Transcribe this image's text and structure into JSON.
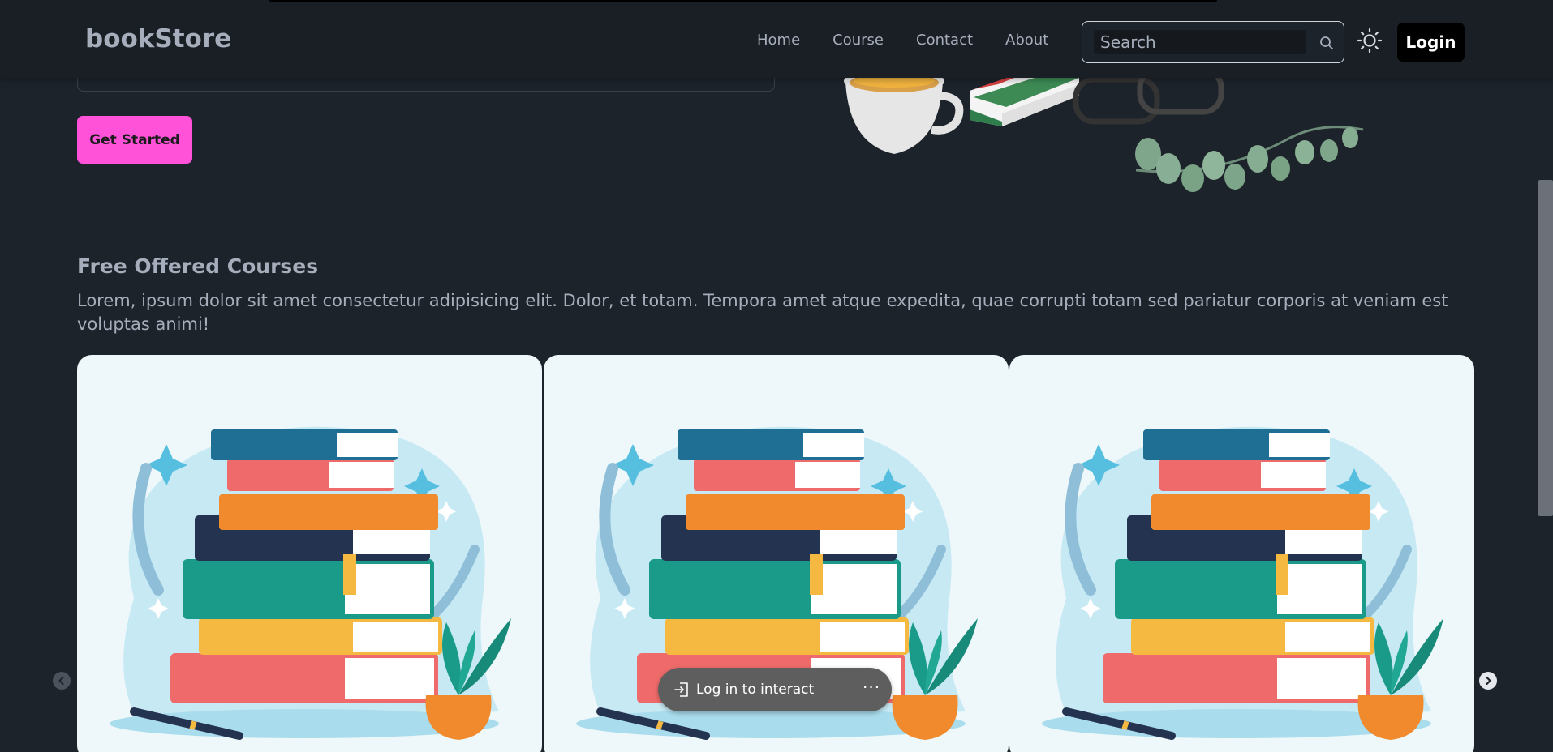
{
  "navbar": {
    "brand": "bookStore",
    "links": [
      "Home",
      "Course",
      "Contact",
      "About"
    ],
    "search_placeholder": "Search",
    "login_label": "Login"
  },
  "hero": {
    "cta_label": "Get Started"
  },
  "courses": {
    "title": "Free Offered Courses",
    "description": "Lorem, ipsum dolor sit amet consectetur adipisicing elit. Dolor, et totam. Tempora amet atque expedita, quae corrupti totam sed pariatur corporis at veniam est voluptas animi!"
  },
  "overlay": {
    "label": "Log in to interact",
    "more": "···"
  },
  "colors": {
    "background": "#1d232a",
    "navbar": "#1a1f25",
    "accent_pink": "#ff52d9",
    "card_bg": "#eef8fa"
  },
  "icons": {
    "search": "search-icon",
    "theme": "sun-icon",
    "prev": "chevron-left-icon",
    "next": "chevron-right-icon",
    "login": "sign-in-icon"
  }
}
